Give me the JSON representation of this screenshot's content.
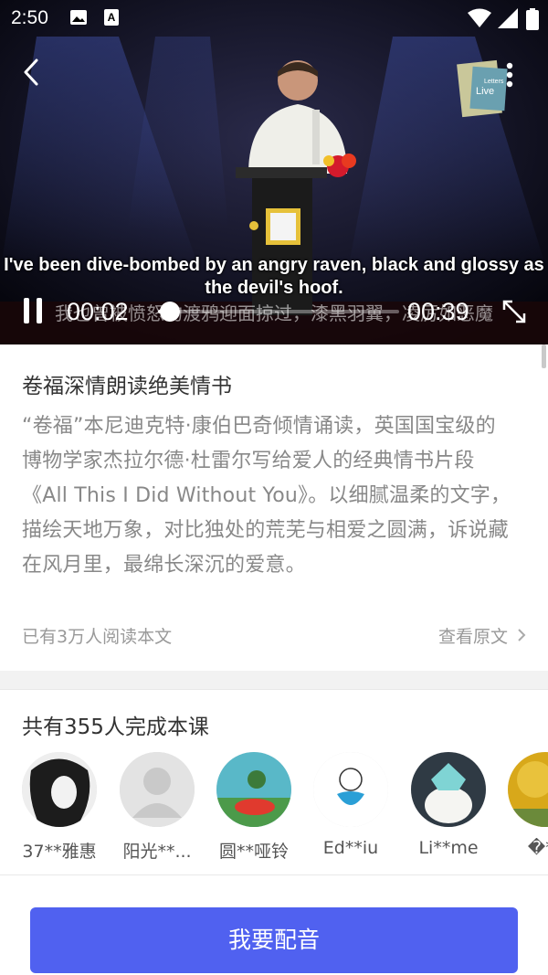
{
  "status_bar": {
    "time": "2:50",
    "icons": [
      "image-icon",
      "text-a-icon",
      "wifi-icon",
      "signal-icon",
      "battery-icon"
    ]
  },
  "video": {
    "subtitle_en": "I've been dive-bombed by an angry raven, black and glossy as the devil's hoof.",
    "subtitle_zh": "我也曾被愤怒的渡鸦迎面掠过，漆黑羽翼，凌厉如恶魔",
    "current_time": "00:02",
    "duration": "00:39",
    "progress_fraction": 0.05,
    "logo_text": "Letters Live"
  },
  "intro": {
    "title": "卷福深情朗读绝美情书",
    "description": "“卷福”本尼迪克特·康伯巴奇倾情诵读，英国国宝级的博物学家杰拉尔德·杜雷尔写给爱人的经典情书片段《All This I Did Without You》。以细腻温柔的文字，描绘天地万象，对比独处的荒芜与相爱之圆满，诉说藏在风月里，最绵长深沉的爱意。",
    "read_count": "已有3万人阅读本文",
    "view_original": "查看原文"
  },
  "completed": {
    "title": "共有355人完成本课",
    "learners": [
      {
        "name": "37**雅惠"
      },
      {
        "name": "阳光**..."
      },
      {
        "name": "圆**哑铃"
      },
      {
        "name": "Ed**iu"
      },
      {
        "name": "Li**me"
      },
      {
        "name": "�**"
      }
    ]
  },
  "action": {
    "label": "我要配音"
  },
  "colors": {
    "accent": "#5061f0"
  }
}
